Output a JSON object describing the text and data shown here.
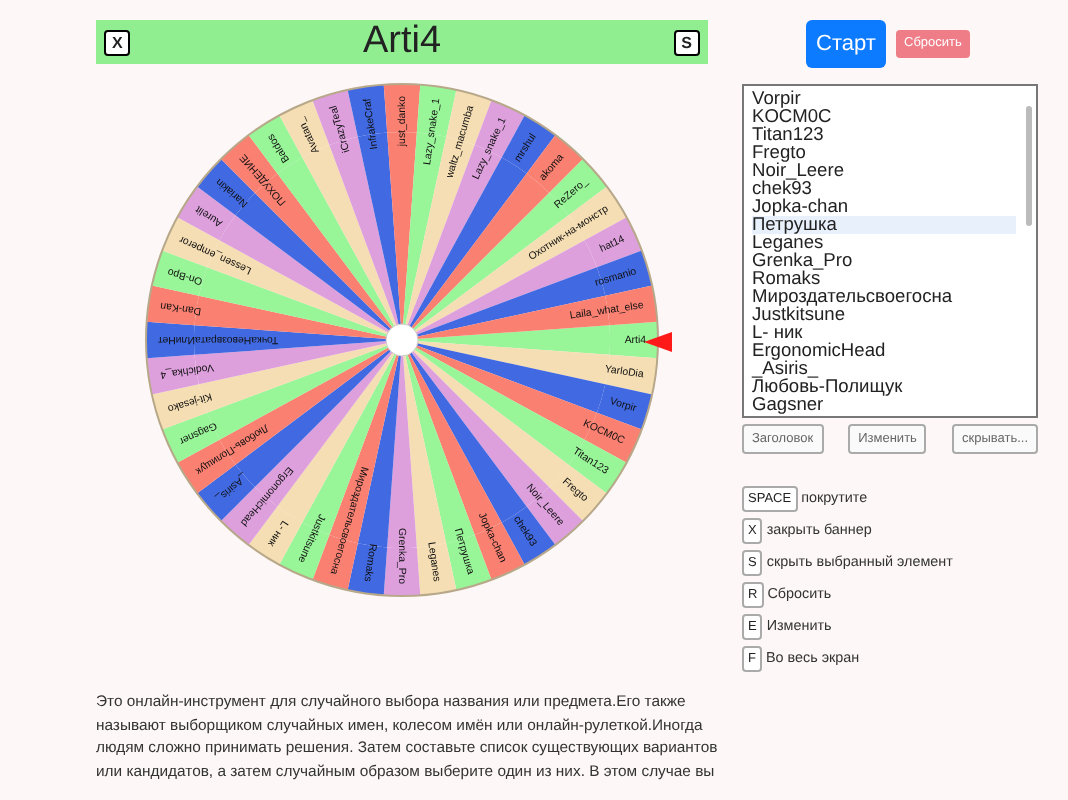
{
  "header": {
    "left_key": "X",
    "title": "Arti4",
    "right_key": "S"
  },
  "wheel": {
    "segments": [
      {
        "label": "Arti4",
        "color": "#98f598"
      },
      {
        "label": "YarloDia",
        "color": "#f5deb3"
      },
      {
        "label": "Vorpir",
        "color": "#4169e1"
      },
      {
        "label": "KOCM0C",
        "color": "#fa8072"
      },
      {
        "label": "Titan123",
        "color": "#98f598"
      },
      {
        "label": "Fregto",
        "color": "#f5deb3"
      },
      {
        "label": "Noir_Leere",
        "color": "#dda0dd"
      },
      {
        "label": "chek93",
        "color": "#4169e1"
      },
      {
        "label": "Jopka-chan",
        "color": "#fa8072"
      },
      {
        "label": "Петрушка",
        "color": "#98f598"
      },
      {
        "label": "Leganes",
        "color": "#f5deb3"
      },
      {
        "label": "Grenka_Pro",
        "color": "#dda0dd"
      },
      {
        "label": "Romaks",
        "color": "#4169e1"
      },
      {
        "label": "Мироздательсвоегосна",
        "color": "#fa8072"
      },
      {
        "label": "Justkitsune",
        "color": "#98f598"
      },
      {
        "label": "L- ник",
        "color": "#f5deb3"
      },
      {
        "label": "ErgonomicHead",
        "color": "#dda0dd"
      },
      {
        "label": "_Asiris_",
        "color": "#4169e1"
      },
      {
        "label": "Любовь-Полищук",
        "color": "#fa8072"
      },
      {
        "label": "Gagsner",
        "color": "#98f598"
      },
      {
        "label": "Kit-jesako",
        "color": "#f5deb3"
      },
      {
        "label": "Vodichka_4",
        "color": "#dda0dd"
      },
      {
        "label": "ТочкаНевозвратаИлиНет",
        "color": "#4169e1"
      },
      {
        "label": "Dan-Kan",
        "color": "#fa8072"
      },
      {
        "label": "On-Bpo",
        "color": "#98f598"
      },
      {
        "label": "Lessen_emperor",
        "color": "#f5deb3"
      },
      {
        "label": "Aurelit",
        "color": "#dda0dd"
      },
      {
        "label": "Nariakin",
        "color": "#4169e1"
      },
      {
        "label": "ПОХУДЕНИЕ",
        "color": "#fa8072"
      },
      {
        "label": "Baldos",
        "color": "#98f598"
      },
      {
        "label": "Avatan_",
        "color": "#f5deb3"
      },
      {
        "label": "iCrazyTeal",
        "color": "#dda0dd"
      },
      {
        "label": "InfrakeCraf",
        "color": "#4169e1"
      },
      {
        "label": "just_danko",
        "color": "#fa8072"
      },
      {
        "label": "Lazy_snake_1",
        "color": "#98f598"
      },
      {
        "label": "waltz_macumba",
        "color": "#f5deb3"
      },
      {
        "label": "Lazy_snake_1",
        "color": "#dda0dd"
      },
      {
        "label": "mrshul",
        "color": "#4169e1"
      },
      {
        "label": "akoma",
        "color": "#fa8072"
      },
      {
        "label": "ReZero_",
        "color": "#98f598"
      },
      {
        "label": "Охотник-на-монстр",
        "color": "#f5deb3"
      },
      {
        "label": "hat14",
        "color": "#dda0dd"
      },
      {
        "label": "rosmanio",
        "color": "#4169e1"
      },
      {
        "label": "Laila_what_else",
        "color": "#fa8072"
      }
    ]
  },
  "start_button": "Старт",
  "reset_button": "Сбросить",
  "names_list": [
    {
      "text": "Vorpir",
      "selected": false
    },
    {
      "text": "KOCM0C",
      "selected": false
    },
    {
      "text": "Titan123",
      "selected": false
    },
    {
      "text": "Fregto",
      "selected": false
    },
    {
      "text": "Noir_Leere",
      "selected": false
    },
    {
      "text": "chek93",
      "selected": false
    },
    {
      "text": "Jopka-chan",
      "selected": false
    },
    {
      "text": "Петрушка",
      "selected": true
    },
    {
      "text": "Leganes",
      "selected": false
    },
    {
      "text": "Grenka_Pro",
      "selected": false
    },
    {
      "text": "Romaks",
      "selected": false
    },
    {
      "text": "Мироздательсвоегосна",
      "selected": false
    },
    {
      "text": "Justkitsune",
      "selected": false
    },
    {
      "text": "L- ник",
      "selected": false
    },
    {
      "text": "ErgonomicHead",
      "selected": false
    },
    {
      "text": "_Asiris_",
      "selected": false
    },
    {
      "text": "Любовь-Полищук",
      "selected": false
    },
    {
      "text": "Gagsner",
      "selected": false
    }
  ],
  "list_buttons": [
    "Заголовок",
    "Изменить",
    "скрывать..."
  ],
  "shortcuts": [
    {
      "key": "SPACE",
      "action": "покрутите"
    },
    {
      "key": "X",
      "action": "закрыть баннер"
    },
    {
      "key": "S",
      "action": "скрыть выбранный элемент"
    },
    {
      "key": "R",
      "action": "Сбросить"
    },
    {
      "key": "E",
      "action": "Изменить"
    },
    {
      "key": "F",
      "action": "Во весь экран"
    }
  ],
  "description": "Это онлайн-инструмент для случайного выбора названия или предмета.Его также называют выборщиком случайных имен, колесом имён или онлайн-рулеткой.Иногда людям сложно принимать решения. Затем составьте список существующих вариантов или кандидатов, а затем случайным образом выберите один из них. В этом случае вы"
}
